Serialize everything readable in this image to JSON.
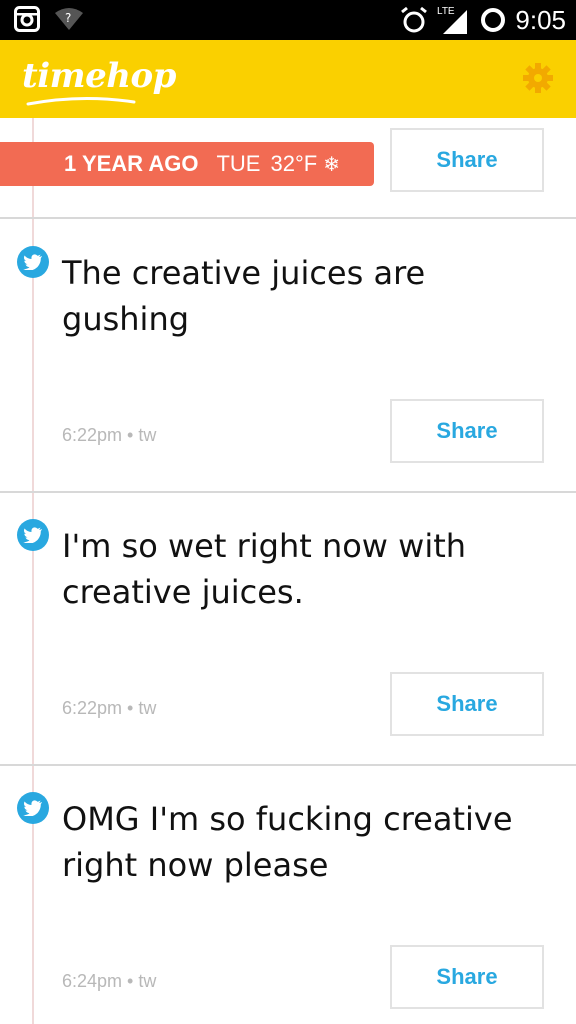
{
  "status_bar": {
    "time": "9:05",
    "network": "LTE",
    "icons": [
      "instagram-icon",
      "wifi-question-icon",
      "alarm-icon",
      "signal-icon",
      "sync-ring-icon"
    ]
  },
  "header": {
    "logo": "timehop",
    "settings_icon": "gear-icon",
    "color": "#fad000"
  },
  "date_header": {
    "ago": "1 YEAR AGO",
    "day": "TUE",
    "temp": "32°F",
    "weather_icon": "snowflake-icon",
    "share_label": "Share",
    "color": "#f26b53"
  },
  "posts": [
    {
      "text": "The creative juices are gushing",
      "time": "6:22pm",
      "source": "tw",
      "share_label": "Share",
      "icon": "twitter-icon"
    },
    {
      "text": "I'm so wet right now with creative juices.",
      "time": "6:22pm",
      "source": "tw",
      "share_label": "Share",
      "icon": "twitter-icon"
    },
    {
      "text": "OMG I'm so fucking creative right now please",
      "time": "6:24pm",
      "source": "tw",
      "share_label": "Share",
      "icon": "twitter-icon"
    }
  ],
  "accent_color": "#29a8e0"
}
